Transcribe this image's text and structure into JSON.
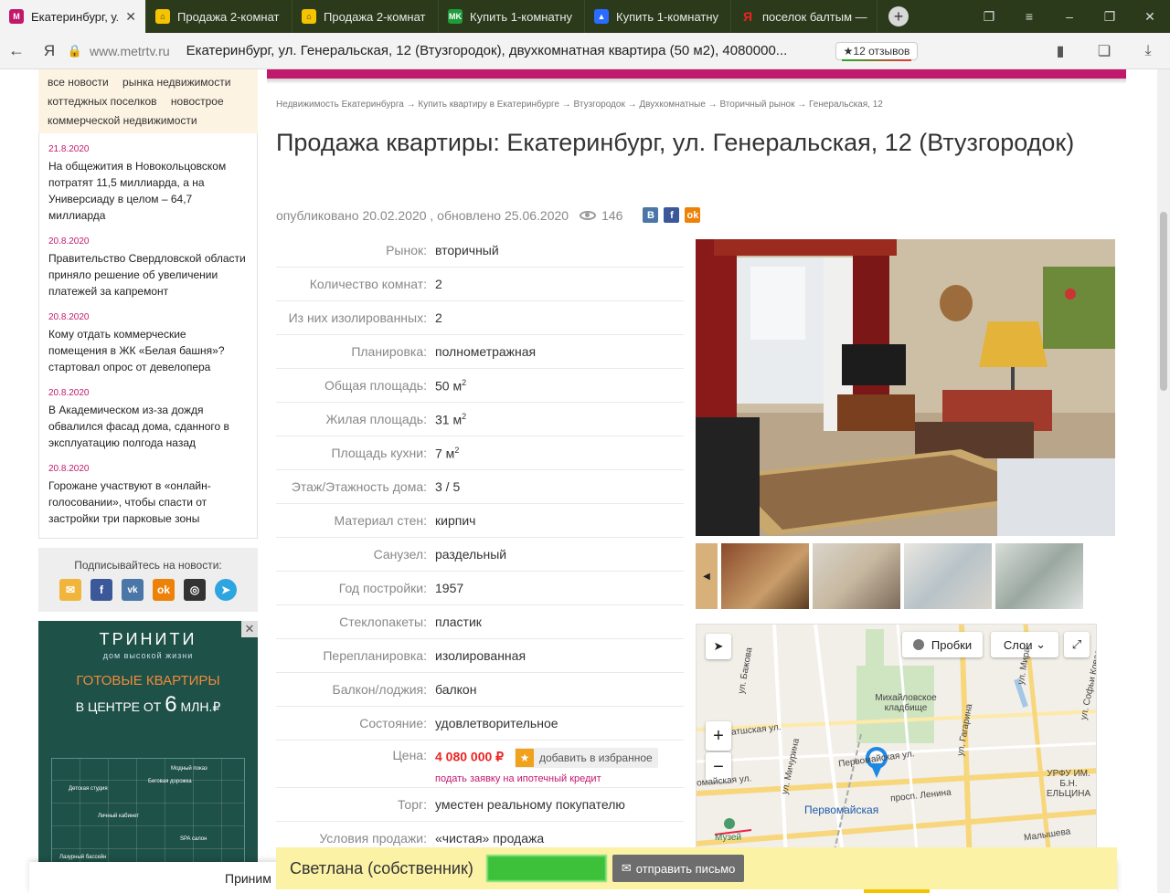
{
  "browser": {
    "tabs": [
      {
        "title": "Екатеринбург, ул",
        "favicon": "metr-icon",
        "active": true
      },
      {
        "title": "Продажа 2-комнат",
        "favicon": "house-icon",
        "active": false
      },
      {
        "title": "Продажа 2-комнат",
        "favicon": "house-icon",
        "active": false
      },
      {
        "title": "Купить 1-комнатну",
        "favicon": "mk-icon",
        "active": false
      },
      {
        "title": "Купить 1-комнатну",
        "favicon": "avito-icon",
        "active": false
      },
      {
        "title": "поселок балтым —",
        "favicon": "yandex-icon",
        "active": false
      }
    ],
    "site": "www.metrtv.ru",
    "page_title": "Екатеринбург, ул. Генеральская, 12 (Втузгородок), двухкомнатная квартира (50 м2), 4080000...",
    "reviews": "★12 отзывов"
  },
  "sidebar": {
    "tags": [
      "все новости",
      "рынка недвижимости",
      "коттеджных поселков",
      "новострое",
      "коммерческой недвижимости"
    ],
    "news": [
      {
        "date": "21.8.2020",
        "title": "На общежития в Новокольцовском потратят 11,5 миллиарда, а на Универсиаду в целом – 64,7 миллиарда"
      },
      {
        "date": "20.8.2020",
        "title": "Правительство Свердловской области приняло решение об увеличении платежей за капремонт"
      },
      {
        "date": "20.8.2020",
        "title": "Кому отдать коммерческие помещения в ЖК «Белая башня»? стартовал опрос от девелопера"
      },
      {
        "date": "20.8.2020",
        "title": "В Академическом из-за дождя обвалился фасад дома, сданного в эксплуатацию полгода назад"
      },
      {
        "date": "20.8.2020",
        "title": "Горожане участвуют в «онлайн-голосовании», чтобы спасти от застройки три парковые зоны"
      }
    ],
    "subscribe_label": "Подписывайтесь на новости:",
    "ad": {
      "logo": "ТРИНИТИ",
      "logo_sub": "дом высокой жизни",
      "headline": "ГОТОВЫЕ КВАРТИРЫ",
      "sub_prefix": "В ЦЕНТРЕ ОТ ",
      "sub_number": "6",
      "sub_suffix": " МЛН.₽",
      "plan_labels": [
        "Модный показ",
        "Беговая дорожка",
        "Детская студия",
        "Личный кабинет",
        "SPA салон",
        "Лазурный бассейн"
      ]
    }
  },
  "breadcrumbs": "Недвижимость Екатеринбурга → Купить квартиру в Екатеринбурге → Втузгородок → Двухкомнатные → Вторичный рынок → Генеральская, 12",
  "listing": {
    "title": "Продажа квартиры: Екатеринбург, ул. Генеральская, 12 (Втузгородок)",
    "published": "опубликовано 20.02.2020 , обновлено 25.06.2020",
    "views": "146",
    "properties": [
      {
        "key": "Рынок:",
        "value": "вторичный"
      },
      {
        "key": "Количество комнат:",
        "value": "2"
      },
      {
        "key": "Из них изолированных:",
        "value": "2"
      },
      {
        "key": "Планировка:",
        "value": "полнометражная"
      },
      {
        "key": "Общая площадь:",
        "value": "50 м",
        "sup": "2"
      },
      {
        "key": "Жилая площадь:",
        "value": "31 м",
        "sup": "2"
      },
      {
        "key": "Площадь кухни:",
        "value": "7 м",
        "sup": "2"
      },
      {
        "key": "Этаж/Этажность дома:",
        "value": "3 / 5"
      },
      {
        "key": "Материал стен:",
        "value": "кирпич"
      },
      {
        "key": "Санузел:",
        "value": "раздельный"
      },
      {
        "key": "Год постройки:",
        "value": "1957"
      },
      {
        "key": "Стеклопакеты:",
        "value": "пластик"
      },
      {
        "key": "Перепланировка:",
        "value": "изолированная"
      },
      {
        "key": "Балкон/лоджия:",
        "value": "балкон"
      },
      {
        "key": "Состояние:",
        "value": "удовлетворительное"
      }
    ],
    "price_label": "Цена:",
    "price": "4 080 000 ₽",
    "favorite_label": "добавить в избранное",
    "mortgage_link": "подать заявку на ипотечный кредит",
    "bargain_label": "Торг:",
    "bargain": "уместен реальному покупателю",
    "conditions_label": "Условия продажи:",
    "conditions": "«чистая» продажа"
  },
  "map": {
    "traffic": "Пробки",
    "layers": "Слои",
    "labels": {
      "cemetery": "Михайловское кладбище",
      "station": "Первомайская",
      "museum": "Музей",
      "urfu": "УРФУ ИМ. Б.Н. ЕЛЬЦИНА",
      "st_lenina": "просп. Ленина",
      "st_pervomayskaya": "Первомайская ул.",
      "st_malysheva": "Малышева",
      "st_bazhova": "ул. Бажова",
      "st_michurina": "ул. Мичурина",
      "st_gagarina": "ул. Гагарина",
      "st_mira": "ул. Мира",
      "st_sofyi": "ул. Софьи Ковалевской",
      "st_krasnoflot": "атшская ул.",
      "st_maya": "омайская ул."
    }
  },
  "contact": {
    "name": "Светлана (собственник)",
    "mail_button": "отправить письмо"
  },
  "cookie_text": "Приним"
}
